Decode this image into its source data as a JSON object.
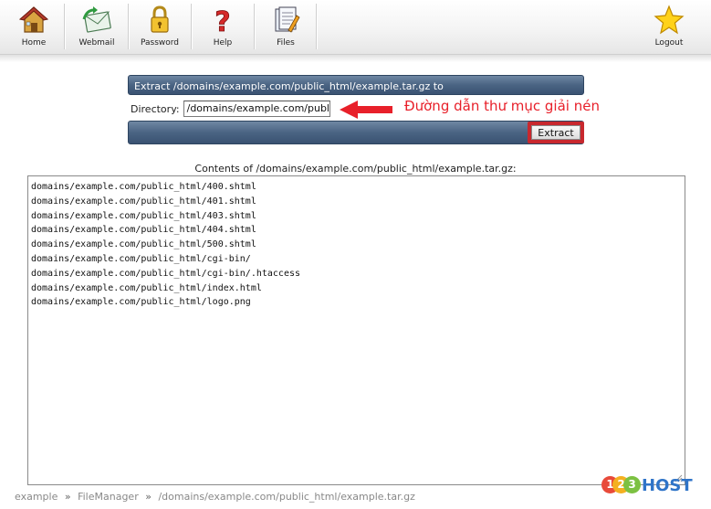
{
  "nav": {
    "home": "Home",
    "webmail": "Webmail",
    "password": "Password",
    "help": "Help",
    "files": "Files",
    "logout": "Logout"
  },
  "extract": {
    "title": "Extract /domains/example.com/public_html/example.tar.gz to",
    "directory_label": "Directory:",
    "directory_value": "/domains/example.com/public_html",
    "button": "Extract"
  },
  "annotation": {
    "text": "Đường dẫn thư mục giải nén",
    "color": "#e8202a"
  },
  "contents": {
    "title": "Contents of /domains/example.com/public_html/example.tar.gz:",
    "files": [
      "domains/example.com/public_html/400.shtml",
      "domains/example.com/public_html/401.shtml",
      "domains/example.com/public_html/403.shtml",
      "domains/example.com/public_html/404.shtml",
      "domains/example.com/public_html/500.shtml",
      "domains/example.com/public_html/cgi-bin/",
      "domains/example.com/public_html/cgi-bin/.htaccess",
      "domains/example.com/public_html/index.html",
      "domains/example.com/public_html/logo.png"
    ]
  },
  "breadcrumb": {
    "items": [
      "example",
      "FileManager",
      "/domains/example.com/public_html/example.tar.gz"
    ],
    "separator": "»"
  },
  "logo": {
    "digit1": "1",
    "digit2": "2",
    "digit3": "3",
    "word": "HOST"
  },
  "colors": {
    "panel_bar": "#4a6483",
    "highlight_border": "#c8282e",
    "logo_blue": "#2f74c8"
  }
}
